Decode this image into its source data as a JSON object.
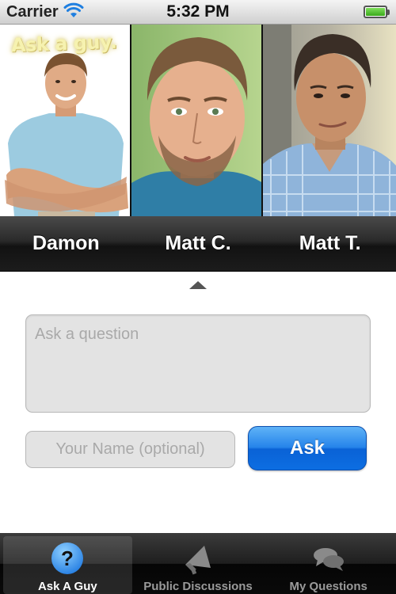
{
  "status_bar": {
    "carrier": "Carrier",
    "time": "5:32 PM",
    "battery_level": 1.0
  },
  "brand": {
    "logo_text": "Ask a guy."
  },
  "guys": [
    {
      "name": "Damon"
    },
    {
      "name": "Matt C."
    },
    {
      "name": "Matt T."
    }
  ],
  "form": {
    "question_placeholder": "Ask a question",
    "question_value": "",
    "name_placeholder": "Your Name (optional)",
    "name_value": "",
    "ask_label": "Ask"
  },
  "tab_bar": {
    "tabs": [
      {
        "label": "Ask A Guy",
        "icon": "question-mark-icon",
        "active": true
      },
      {
        "label": "Public Discussions",
        "icon": "megaphone-icon",
        "active": false
      },
      {
        "label": "My Questions",
        "icon": "chat-bubbles-icon",
        "active": false
      }
    ]
  },
  "colors": {
    "accent": "#1a7ae6",
    "active_tab_icon": "#3a9af0",
    "brand_logo": "#f6f2b0"
  }
}
